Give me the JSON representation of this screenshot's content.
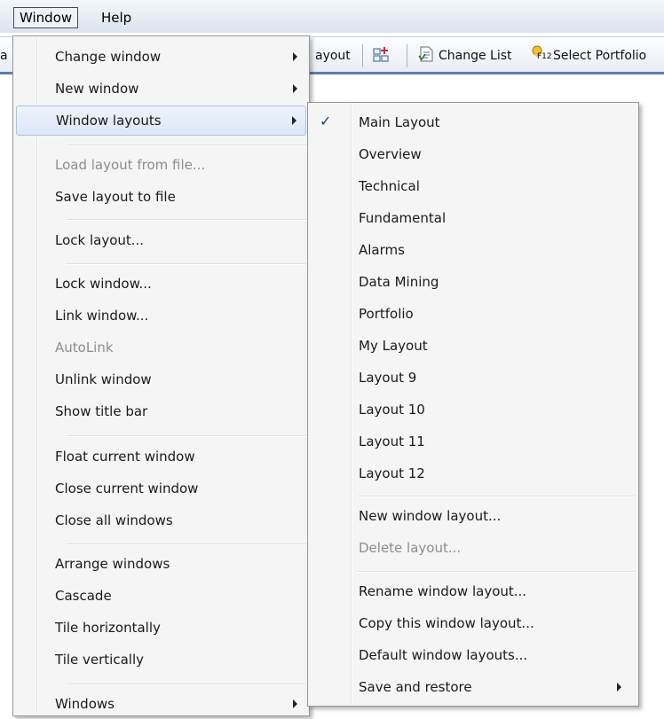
{
  "menubar": {
    "window_label": "Window",
    "help_label": "Help"
  },
  "toolbar": {
    "left_fragment": "a",
    "layout_fragment": "ayout",
    "change_list_label": "Change List",
    "select_portfolio_label": "Select Portfolio",
    "f12_badge": "F12"
  },
  "window_menu": {
    "items": [
      {
        "label": "Change window"
      },
      {
        "label": "New window"
      },
      {
        "label": "Window layouts"
      },
      {
        "label": "Load layout from file..."
      },
      {
        "label": "Save layout to file"
      },
      {
        "label": "Lock layout..."
      },
      {
        "label": "Lock window..."
      },
      {
        "label": "Link window..."
      },
      {
        "label": "AutoLink"
      },
      {
        "label": "Unlink window"
      },
      {
        "label": "Show title bar"
      },
      {
        "label": "Float current window"
      },
      {
        "label": "Close current window"
      },
      {
        "label": "Close all windows"
      },
      {
        "label": "Arrange windows"
      },
      {
        "label": "Cascade"
      },
      {
        "label": "Tile horizontally"
      },
      {
        "label": "Tile vertically"
      },
      {
        "label": "Windows"
      }
    ]
  },
  "layouts_submenu": {
    "checkmark": "✓",
    "items": [
      {
        "label": "Main Layout"
      },
      {
        "label": "Overview"
      },
      {
        "label": "Technical"
      },
      {
        "label": "Fundamental"
      },
      {
        "label": "Alarms"
      },
      {
        "label": "Data Mining"
      },
      {
        "label": "Portfolio"
      },
      {
        "label": "My Layout"
      },
      {
        "label": "Layout 9"
      },
      {
        "label": "Layout 10"
      },
      {
        "label": "Layout 11"
      },
      {
        "label": "Layout 12"
      },
      {
        "label": "New window layout..."
      },
      {
        "label": "Delete layout..."
      },
      {
        "label": "Rename window layout..."
      },
      {
        "label": "Copy this window layout..."
      },
      {
        "label": "Default window layouts..."
      },
      {
        "label": "Save and restore"
      }
    ]
  },
  "colors": {
    "highlight_border": "#a8c4e8",
    "menu_background": "#f5f5f5",
    "disabled_text": "#8d8d8d",
    "checkmark": "#1f3f7a"
  }
}
